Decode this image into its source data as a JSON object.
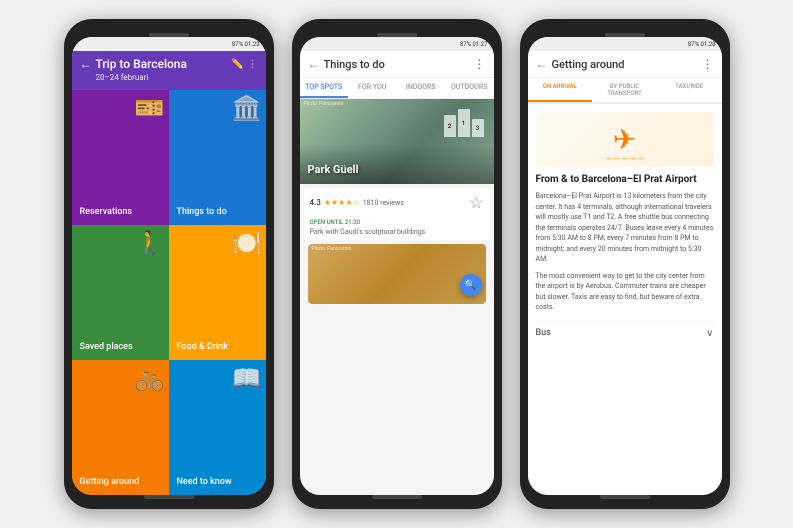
{
  "phone1": {
    "status": "87% 01:23",
    "header": {
      "title": "Trip to Barcelona",
      "date": "20–24 februari"
    },
    "grid": [
      {
        "id": "reservations",
        "label": "Reservations",
        "icon": "🎫",
        "color": "#7B1FA2"
      },
      {
        "id": "things-to-do",
        "label": "Things to do",
        "icon": "🏛️",
        "color": "#1976D2"
      },
      {
        "id": "saved-places",
        "label": "Saved places",
        "icon": "🚶",
        "color": "#388E3C"
      },
      {
        "id": "food-drink",
        "label": "Food & Drink",
        "icon": "🍽️",
        "color": "#FFA000"
      },
      {
        "id": "getting-around",
        "label": "Getting around",
        "icon": "🚲",
        "color": "#F57C00"
      },
      {
        "id": "need-to-know",
        "label": "Need to know",
        "icon": "📖",
        "color": "#0288D1"
      }
    ]
  },
  "phone2": {
    "status": "87% 01:27",
    "header": {
      "title": "Things to do"
    },
    "tabs": [
      "TOP SPOTS",
      "FOR YOU",
      "INDOORS",
      "OUTDOORS"
    ],
    "active_tab": 0,
    "place": {
      "name": "Park Güell",
      "rating": "4.3",
      "reviews": "1810 reviews",
      "open_status": "OPEN UNTIL 21:30",
      "type": "Park with Gaudí's sculptural buildings",
      "photo_credit1": "Photo: Panoramio",
      "photo_credit2": "Photo: Panoramio"
    }
  },
  "phone3": {
    "status": "87% 01:28",
    "header": {
      "title": "Getting around"
    },
    "tabs": [
      "ON ARRIVAL",
      "BY PUBLIC TRANSPORT",
      "TAXI/RIDE"
    ],
    "active_tab": 0,
    "content": {
      "title": "From & to Barcelona–El Prat Airport",
      "para1": "Barcelona–El Prat Airport is 13 kilometers from the city center. It has 4 terminals, although international travelers will mostly use T1 and T2. A free shuttle bus connecting the terminals operates 24/7. Buses leave every 4 minutes from 5:30 AM to 8 PM, every 7 minutes from 8 PM to midnight; and every 20 minutes from midnight to 5:30 AM.",
      "para2": "The most convenient way to get to the city center from the airport is by Aerobus. Commuter trains are cheaper but slower. Taxis are easy to find, but beware of extra costs.",
      "bus_label": "Bus",
      "aerobus_link": "Aerobus"
    }
  }
}
